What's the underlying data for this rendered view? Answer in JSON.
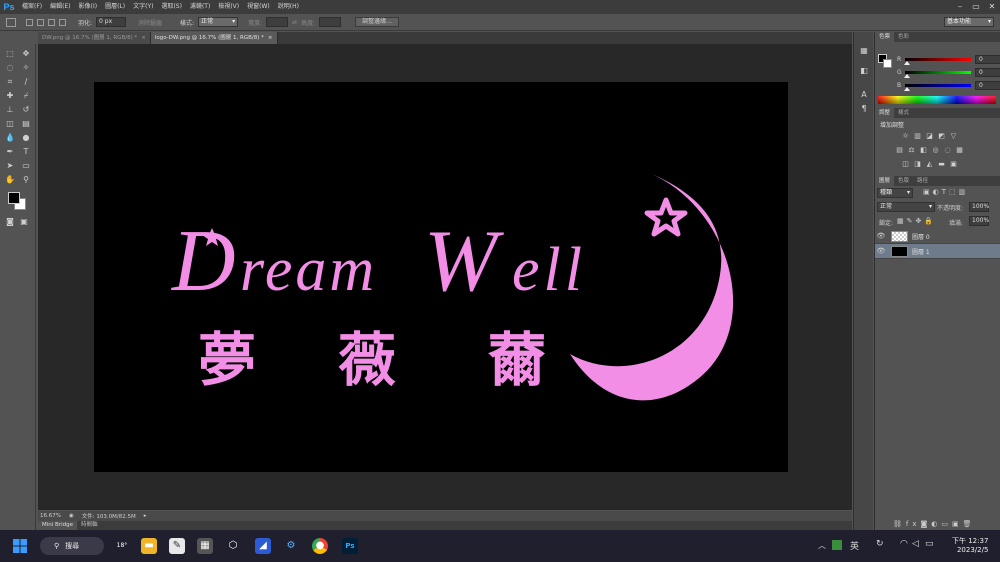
{
  "app": {
    "logo": "Ps",
    "menu": [
      "檔案(F)",
      "編輯(E)",
      "影像(I)",
      "圖層(L)",
      "文字(Y)",
      "選取(S)",
      "濾鏡(T)",
      "檢視(V)",
      "視窗(W)",
      "說明(H)"
    ],
    "window_controls": [
      "–",
      "▭",
      "✕"
    ]
  },
  "options_bar": {
    "feather_label": "羽化:",
    "feather_value": "0 px",
    "antialias_label": "消除鋸齒",
    "style_label": "樣式:",
    "style_value": "正常",
    "width_label": "寬度:",
    "height_label": "高度:",
    "refine_edge_button": "調整邊緣...",
    "workspace": "基本功能"
  },
  "tabs": [
    {
      "label": "DW.png @ 16.7% (圖層 1, RGB/8) *",
      "close": "×",
      "active": false
    },
    {
      "label": "logo-DW.png @ 16.7% (圖層 1, RGB/8) *",
      "close": "×",
      "active": true
    }
  ],
  "canvas": {
    "logo_text_d": "D",
    "logo_text_ream": "ream",
    "logo_text_w": "W",
    "logo_text_ell": "ell",
    "chinese_1": "夢",
    "chinese_2": "薇",
    "chinese_3": "薾",
    "logo_color": "#f28ee6",
    "background_color": "#000000"
  },
  "status": {
    "zoom": "16.67%",
    "doc_size": "文件: 103.0M/82.5M"
  },
  "bottom_tabs": [
    "Mini Bridge",
    "時間軸"
  ],
  "color_panel": {
    "tabs": [
      "色票",
      "色彩"
    ],
    "r_label": "R",
    "g_label": "G",
    "b_label": "B",
    "r_value": "0",
    "g_value": "0",
    "b_value": "0"
  },
  "adjust_panel": {
    "tabs": [
      "調整",
      "樣式"
    ],
    "title": "增加調整"
  },
  "layers_panel": {
    "tabs": [
      "圖層",
      "色版",
      "路徑"
    ],
    "kind_filter": "種類",
    "blend_mode": "正常",
    "opacity_label": "不透明度:",
    "opacity_value": "100%",
    "lock_label": "鎖定:",
    "fill_label": "填滿:",
    "fill_value": "100%",
    "layers": [
      {
        "name": "圖層 0",
        "selected": false
      },
      {
        "name": "圖層 1",
        "selected": true
      }
    ]
  },
  "taskbar": {
    "search_label": "搜尋",
    "weather_temp": "18°",
    "ime_label": "英",
    "time": "下午 12:37",
    "date": "2023/2/5"
  }
}
